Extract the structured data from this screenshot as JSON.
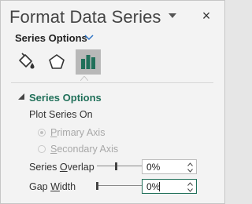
{
  "pane": {
    "title": "Format Data Series",
    "dropdown_icon": "caret-down-icon",
    "close_glyph": "×",
    "subheader": "Series Options",
    "subheader_icon": "chevron-down-icon",
    "accent_color": "#21705a"
  },
  "tabs": [
    {
      "name": "Fill & Line",
      "icon": "paint-bucket-icon",
      "selected": false
    },
    {
      "name": "Effects",
      "icon": "pentagon-icon",
      "selected": false
    },
    {
      "name": "Series Options",
      "icon": "bar-chart-icon",
      "selected": true
    }
  ],
  "section": {
    "title": "Series Options",
    "expanded": true
  },
  "plot_on": {
    "label": "Plot Series On",
    "primary_pre": "",
    "primary_u": "P",
    "primary_post": "rimary Axis",
    "secondary_pre": "",
    "secondary_u": "S",
    "secondary_post": "econdary Axis",
    "selected": "primary",
    "enabled": false
  },
  "overlap": {
    "label_pre": "Series ",
    "label_u": "O",
    "label_post": "verlap",
    "value": "0%",
    "level": 0
  },
  "gap": {
    "label_pre": "Gap ",
    "label_u": "W",
    "label_post": "idth",
    "value": "0%",
    "level": 0,
    "focused": true
  }
}
